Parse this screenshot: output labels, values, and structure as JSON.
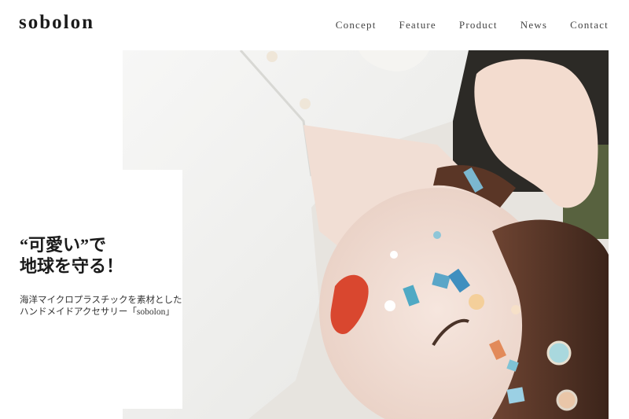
{
  "header": {
    "logo": "sobolon",
    "nav": [
      {
        "label": "Concept"
      },
      {
        "label": "Feature"
      },
      {
        "label": "Product"
      },
      {
        "label": "News"
      },
      {
        "label": "Contact"
      }
    ]
  },
  "hero": {
    "headline_lines": [
      "“可愛い”で",
      "地球を守る！"
    ],
    "subtext_lines": [
      "海洋マイクロプラスチックを素材とした",
      "ハンドメイドアクセサリー「sobolon」"
    ],
    "image": "woman-lying-with-seaglass-face-decoration-photo"
  },
  "colors": {
    "background": "#ffffff",
    "text": "#1a1a1a",
    "nav_text": "#444444",
    "accent_lip": "#d9472f",
    "accent_seaglass": "#4fa9c4"
  }
}
